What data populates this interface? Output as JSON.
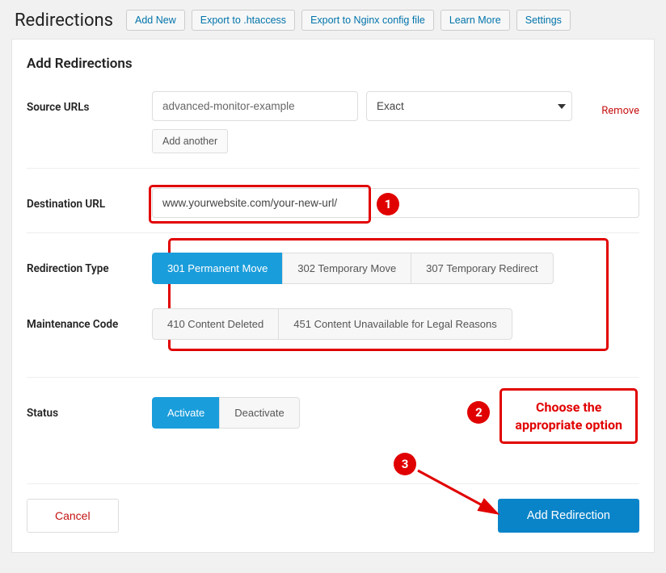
{
  "header": {
    "title": "Redirections",
    "buttons": {
      "add_new": "Add New",
      "export_htaccess": "Export to .htaccess",
      "export_nginx": "Export to Nginx config file",
      "learn_more": "Learn More",
      "settings": "Settings"
    }
  },
  "panel": {
    "heading": "Add Redirections",
    "labels": {
      "source_urls": "Source URLs",
      "destination_url": "Destination URL",
      "redirection_type": "Redirection Type",
      "maintenance_code": "Maintenance Code",
      "status": "Status"
    },
    "source": {
      "value": "advanced-monitor-example",
      "match_selected": "Exact",
      "remove": "Remove",
      "add_another": "Add another"
    },
    "destination": {
      "value": "www.yourwebsite.com/your-new-url/"
    },
    "redirection_types": {
      "r301": "301 Permanent Move",
      "r302": "302 Temporary Move",
      "r307": "307 Temporary Redirect"
    },
    "maintenance_codes": {
      "m410": "410 Content Deleted",
      "m451": "451 Content Unavailable for Legal Reasons"
    },
    "status_options": {
      "activate": "Activate",
      "deactivate": "Deactivate"
    },
    "footer": {
      "cancel": "Cancel",
      "submit": "Add Redirection"
    }
  },
  "annotations": {
    "one": "1",
    "two": "2",
    "three": "3",
    "note_line1": "Choose the",
    "note_line2": "appropriate option"
  }
}
